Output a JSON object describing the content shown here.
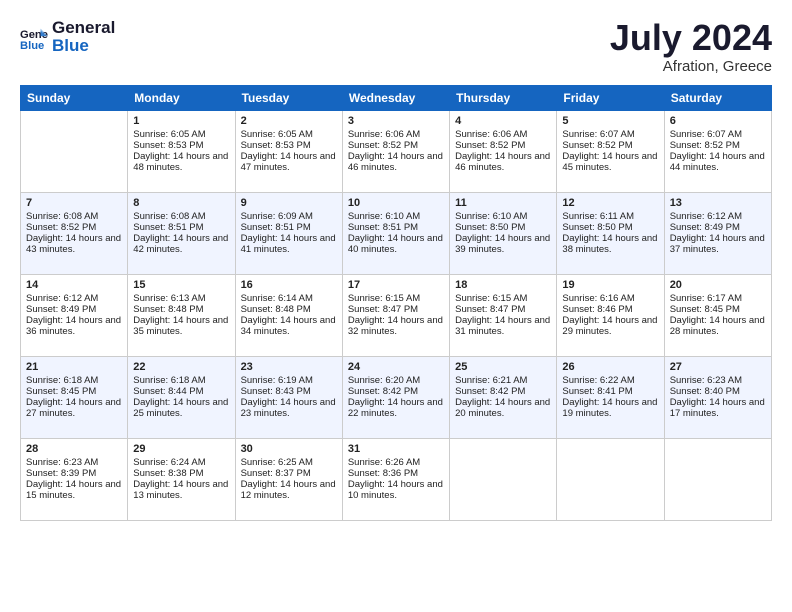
{
  "logo": {
    "text_general": "General",
    "text_blue": "Blue"
  },
  "header": {
    "month": "July 2024",
    "location": "Afration, Greece"
  },
  "weekdays": [
    "Sunday",
    "Monday",
    "Tuesday",
    "Wednesday",
    "Thursday",
    "Friday",
    "Saturday"
  ],
  "weeks": [
    [
      {
        "day": "",
        "sunrise": "",
        "sunset": "",
        "daylight": ""
      },
      {
        "day": "1",
        "sunrise": "Sunrise: 6:05 AM",
        "sunset": "Sunset: 8:53 PM",
        "daylight": "Daylight: 14 hours and 48 minutes."
      },
      {
        "day": "2",
        "sunrise": "Sunrise: 6:05 AM",
        "sunset": "Sunset: 8:53 PM",
        "daylight": "Daylight: 14 hours and 47 minutes."
      },
      {
        "day": "3",
        "sunrise": "Sunrise: 6:06 AM",
        "sunset": "Sunset: 8:52 PM",
        "daylight": "Daylight: 14 hours and 46 minutes."
      },
      {
        "day": "4",
        "sunrise": "Sunrise: 6:06 AM",
        "sunset": "Sunset: 8:52 PM",
        "daylight": "Daylight: 14 hours and 46 minutes."
      },
      {
        "day": "5",
        "sunrise": "Sunrise: 6:07 AM",
        "sunset": "Sunset: 8:52 PM",
        "daylight": "Daylight: 14 hours and 45 minutes."
      },
      {
        "day": "6",
        "sunrise": "Sunrise: 6:07 AM",
        "sunset": "Sunset: 8:52 PM",
        "daylight": "Daylight: 14 hours and 44 minutes."
      }
    ],
    [
      {
        "day": "7",
        "sunrise": "Sunrise: 6:08 AM",
        "sunset": "Sunset: 8:52 PM",
        "daylight": "Daylight: 14 hours and 43 minutes."
      },
      {
        "day": "8",
        "sunrise": "Sunrise: 6:08 AM",
        "sunset": "Sunset: 8:51 PM",
        "daylight": "Daylight: 14 hours and 42 minutes."
      },
      {
        "day": "9",
        "sunrise": "Sunrise: 6:09 AM",
        "sunset": "Sunset: 8:51 PM",
        "daylight": "Daylight: 14 hours and 41 minutes."
      },
      {
        "day": "10",
        "sunrise": "Sunrise: 6:10 AM",
        "sunset": "Sunset: 8:51 PM",
        "daylight": "Daylight: 14 hours and 40 minutes."
      },
      {
        "day": "11",
        "sunrise": "Sunrise: 6:10 AM",
        "sunset": "Sunset: 8:50 PM",
        "daylight": "Daylight: 14 hours and 39 minutes."
      },
      {
        "day": "12",
        "sunrise": "Sunrise: 6:11 AM",
        "sunset": "Sunset: 8:50 PM",
        "daylight": "Daylight: 14 hours and 38 minutes."
      },
      {
        "day": "13",
        "sunrise": "Sunrise: 6:12 AM",
        "sunset": "Sunset: 8:49 PM",
        "daylight": "Daylight: 14 hours and 37 minutes."
      }
    ],
    [
      {
        "day": "14",
        "sunrise": "Sunrise: 6:12 AM",
        "sunset": "Sunset: 8:49 PM",
        "daylight": "Daylight: 14 hours and 36 minutes."
      },
      {
        "day": "15",
        "sunrise": "Sunrise: 6:13 AM",
        "sunset": "Sunset: 8:48 PM",
        "daylight": "Daylight: 14 hours and 35 minutes."
      },
      {
        "day": "16",
        "sunrise": "Sunrise: 6:14 AM",
        "sunset": "Sunset: 8:48 PM",
        "daylight": "Daylight: 14 hours and 34 minutes."
      },
      {
        "day": "17",
        "sunrise": "Sunrise: 6:15 AM",
        "sunset": "Sunset: 8:47 PM",
        "daylight": "Daylight: 14 hours and 32 minutes."
      },
      {
        "day": "18",
        "sunrise": "Sunrise: 6:15 AM",
        "sunset": "Sunset: 8:47 PM",
        "daylight": "Daylight: 14 hours and 31 minutes."
      },
      {
        "day": "19",
        "sunrise": "Sunrise: 6:16 AM",
        "sunset": "Sunset: 8:46 PM",
        "daylight": "Daylight: 14 hours and 29 minutes."
      },
      {
        "day": "20",
        "sunrise": "Sunrise: 6:17 AM",
        "sunset": "Sunset: 8:45 PM",
        "daylight": "Daylight: 14 hours and 28 minutes."
      }
    ],
    [
      {
        "day": "21",
        "sunrise": "Sunrise: 6:18 AM",
        "sunset": "Sunset: 8:45 PM",
        "daylight": "Daylight: 14 hours and 27 minutes."
      },
      {
        "day": "22",
        "sunrise": "Sunrise: 6:18 AM",
        "sunset": "Sunset: 8:44 PM",
        "daylight": "Daylight: 14 hours and 25 minutes."
      },
      {
        "day": "23",
        "sunrise": "Sunrise: 6:19 AM",
        "sunset": "Sunset: 8:43 PM",
        "daylight": "Daylight: 14 hours and 23 minutes."
      },
      {
        "day": "24",
        "sunrise": "Sunrise: 6:20 AM",
        "sunset": "Sunset: 8:42 PM",
        "daylight": "Daylight: 14 hours and 22 minutes."
      },
      {
        "day": "25",
        "sunrise": "Sunrise: 6:21 AM",
        "sunset": "Sunset: 8:42 PM",
        "daylight": "Daylight: 14 hours and 20 minutes."
      },
      {
        "day": "26",
        "sunrise": "Sunrise: 6:22 AM",
        "sunset": "Sunset: 8:41 PM",
        "daylight": "Daylight: 14 hours and 19 minutes."
      },
      {
        "day": "27",
        "sunrise": "Sunrise: 6:23 AM",
        "sunset": "Sunset: 8:40 PM",
        "daylight": "Daylight: 14 hours and 17 minutes."
      }
    ],
    [
      {
        "day": "28",
        "sunrise": "Sunrise: 6:23 AM",
        "sunset": "Sunset: 8:39 PM",
        "daylight": "Daylight: 14 hours and 15 minutes."
      },
      {
        "day": "29",
        "sunrise": "Sunrise: 6:24 AM",
        "sunset": "Sunset: 8:38 PM",
        "daylight": "Daylight: 14 hours and 13 minutes."
      },
      {
        "day": "30",
        "sunrise": "Sunrise: 6:25 AM",
        "sunset": "Sunset: 8:37 PM",
        "daylight": "Daylight: 14 hours and 12 minutes."
      },
      {
        "day": "31",
        "sunrise": "Sunrise: 6:26 AM",
        "sunset": "Sunset: 8:36 PM",
        "daylight": "Daylight: 14 hours and 10 minutes."
      },
      {
        "day": "",
        "sunrise": "",
        "sunset": "",
        "daylight": ""
      },
      {
        "day": "",
        "sunrise": "",
        "sunset": "",
        "daylight": ""
      },
      {
        "day": "",
        "sunrise": "",
        "sunset": "",
        "daylight": ""
      }
    ]
  ]
}
